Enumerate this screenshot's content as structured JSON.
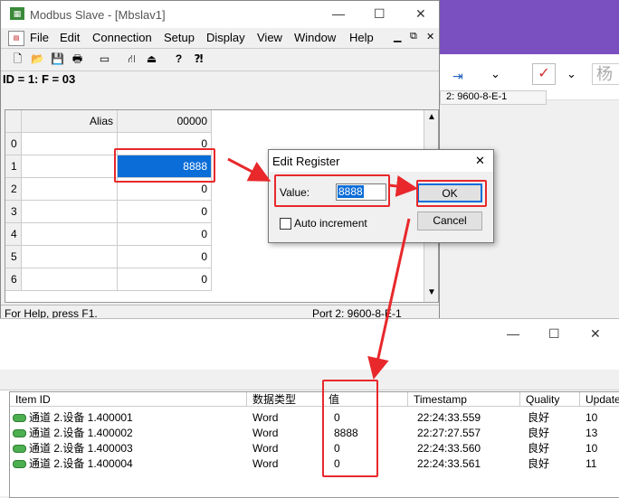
{
  "bg_app": {
    "partial_text": "杨"
  },
  "modbus": {
    "title": "Modbus Slave - [Mbslav1]",
    "menu": [
      "File",
      "Edit",
      "Connection",
      "Setup",
      "Display",
      "View",
      "Window",
      "Help"
    ],
    "id_line": "ID = 1: F = 03",
    "grid": {
      "col_alias": "Alias",
      "col_addr": "00000",
      "rows": [
        {
          "idx": "0",
          "value": "0"
        },
        {
          "idx": "1",
          "value": "8888"
        },
        {
          "idx": "2",
          "value": "0"
        },
        {
          "idx": "3",
          "value": "0"
        },
        {
          "idx": "4",
          "value": "0"
        },
        {
          "idx": "5",
          "value": "0"
        },
        {
          "idx": "6",
          "value": "0"
        }
      ]
    },
    "status_left": "For Help, press F1.",
    "status_right": "Port 2: 9600-8-E-1",
    "tab_behind": "2: 9600-8-E-1"
  },
  "dialog": {
    "title": "Edit Register",
    "value_label": "Value:",
    "value": "8888",
    "ok": "OK",
    "cancel": "Cancel",
    "auto_increment": "Auto increment"
  },
  "bottom": {
    "headers": [
      "Item ID",
      "数据类型",
      "值",
      "Timestamp",
      "Quality",
      "Update"
    ],
    "rows": [
      {
        "item": "通道 2.设备 1.400001",
        "type": "Word",
        "value": "0",
        "ts": "22:24:33.559",
        "quality": "良好",
        "update": "10"
      },
      {
        "item": "通道 2.设备 1.400002",
        "type": "Word",
        "value": "8888",
        "ts": "22:27:27.557",
        "quality": "良好",
        "update": "13"
      },
      {
        "item": "通道 2.设备 1.400003",
        "type": "Word",
        "value": "0",
        "ts": "22:24:33.560",
        "quality": "良好",
        "update": "10"
      },
      {
        "item": "通道 2.设备 1.400004",
        "type": "Word",
        "value": "0",
        "ts": "22:24:33.561",
        "quality": "良好",
        "update": "11"
      }
    ]
  }
}
